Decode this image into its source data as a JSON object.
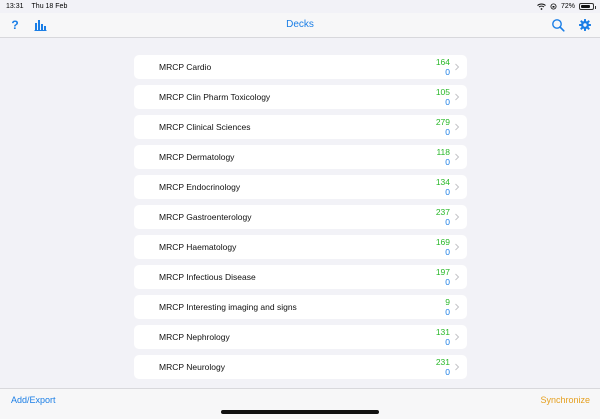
{
  "status": {
    "time": "13:31",
    "date": "Thu 18 Feb",
    "battery": "72%",
    "battery_level": 0.72
  },
  "nav": {
    "title": "Decks",
    "help_label": "?"
  },
  "colors": {
    "accent": "#1a7ee6",
    "new_count": "#28b828",
    "sync": "#e5a020"
  },
  "decks": [
    {
      "name": "MRCP Cardio",
      "new": "164",
      "due": "0"
    },
    {
      "name": "MRCP Clin Pharm Toxicology",
      "new": "105",
      "due": "0"
    },
    {
      "name": "MRCP Clinical Sciences",
      "new": "279",
      "due": "0"
    },
    {
      "name": "MRCP Dermatology",
      "new": "118",
      "due": "0"
    },
    {
      "name": "MRCP Endocrinology",
      "new": "134",
      "due": "0"
    },
    {
      "name": "MRCP Gastroenterology",
      "new": "237",
      "due": "0"
    },
    {
      "name": "MRCP Haematology",
      "new": "169",
      "due": "0"
    },
    {
      "name": "MRCP Infectious Disease",
      "new": "197",
      "due": "0"
    },
    {
      "name": "MRCP Interesting imaging and signs",
      "new": "9",
      "due": "0"
    },
    {
      "name": "MRCP Nephrology",
      "new": "131",
      "due": "0"
    },
    {
      "name": "MRCP Neurology",
      "new": "231",
      "due": "0"
    }
  ],
  "bottom": {
    "add_export": "Add/Export",
    "synchronize": "Synchronize"
  }
}
